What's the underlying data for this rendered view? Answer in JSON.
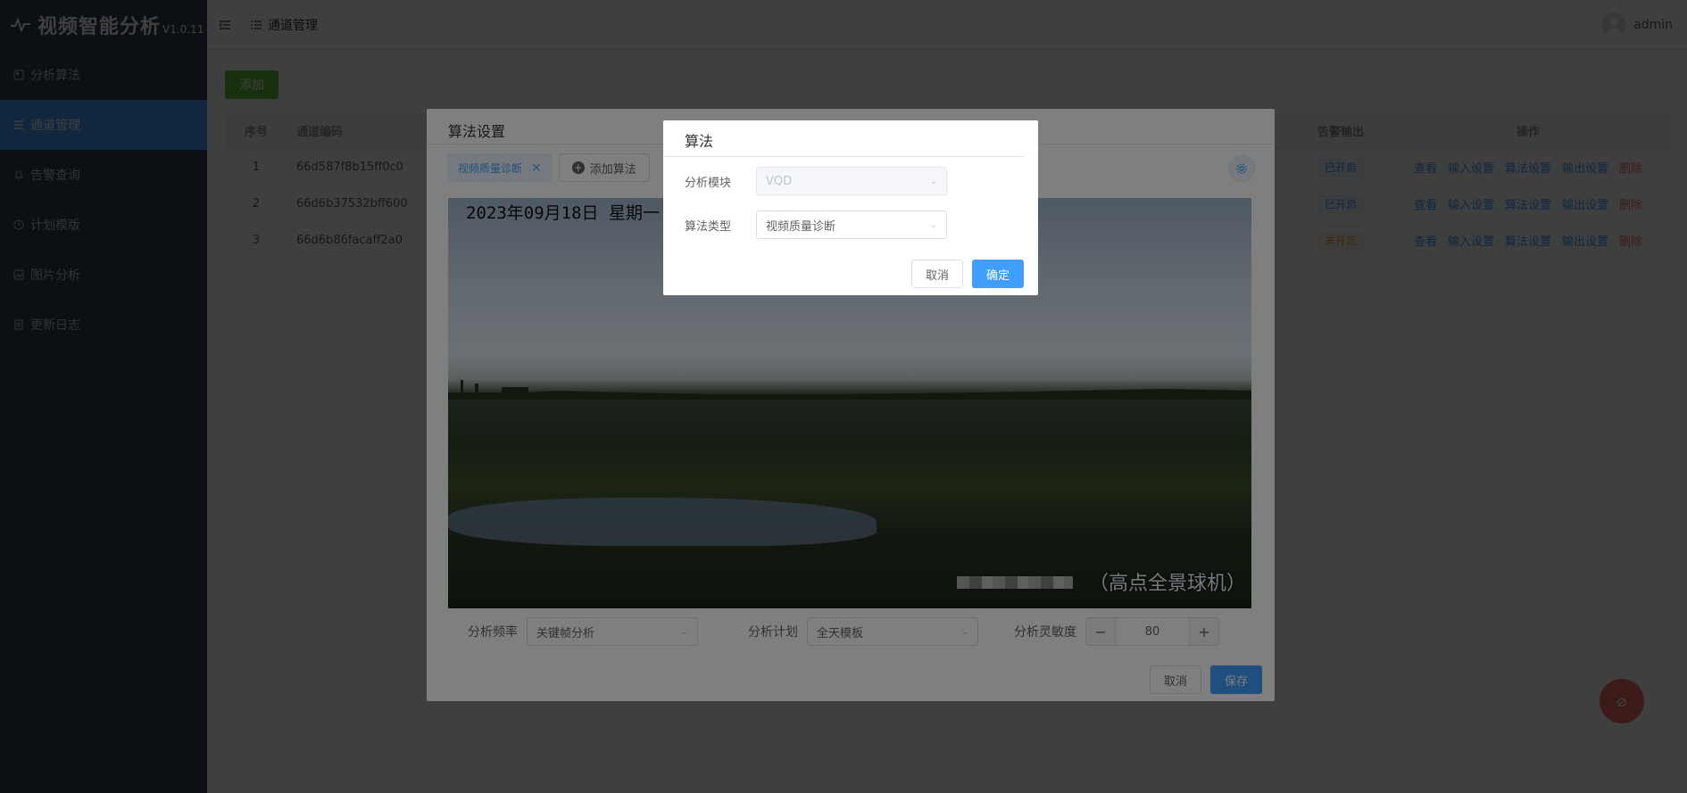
{
  "app": {
    "title": "视频智能分析",
    "version": "V1.0.11"
  },
  "sidebar": {
    "items": [
      {
        "label": "分析算法",
        "icon": "algorithm-icon"
      },
      {
        "label": "通道管理",
        "icon": "list-icon",
        "active": true
      },
      {
        "label": "告警查询",
        "icon": "bell-icon"
      },
      {
        "label": "计划模版",
        "icon": "clock-icon"
      },
      {
        "label": "图片分析",
        "icon": "image-icon"
      },
      {
        "label": "更新日志",
        "icon": "document-icon"
      }
    ]
  },
  "header": {
    "breadcrumb": "通道管理",
    "user": "admin"
  },
  "toolbar": {
    "add_label": "添加"
  },
  "table": {
    "headers": {
      "index": "序号",
      "code": "通道编码",
      "alarm_output": "告警输出",
      "actions": "操作"
    },
    "rows": [
      {
        "index": "1",
        "code": "66d587f8b15ff0c0",
        "alarm": "已开启",
        "alarm_on": true
      },
      {
        "index": "2",
        "code": "66d6b37532bff600",
        "alarm": "已开启",
        "alarm_on": true
      },
      {
        "index": "3",
        "code": "66d6b86facaff2a0",
        "alarm": "未开启",
        "alarm_on": false
      }
    ],
    "actions": {
      "view": "查看",
      "input": "输入设置",
      "algorithm": "算法设置",
      "output": "输出设置",
      "delete": "删除"
    }
  },
  "algo_dialog": {
    "title": "算法设置",
    "tag": "视频质量诊断",
    "add_algorithm": "添加算法",
    "video": {
      "osd": "2023年09月18日  星期一",
      "caption": "（高点全景球机）"
    },
    "params": {
      "frequency_label": "分析频率",
      "frequency_value": "关键帧分析",
      "plan_label": "分析计划",
      "plan_value": "全天模板",
      "sensitivity_label": "分析灵敏度",
      "sensitivity_value": "80"
    },
    "cancel": "取消",
    "save": "保存"
  },
  "inner_dialog": {
    "title": "算法",
    "module_label": "分析模块",
    "module_value": "VQD",
    "type_label": "算法类型",
    "type_value": "视频质量诊断",
    "cancel": "取消",
    "confirm": "确定"
  },
  "colors": {
    "primary": "#409eff",
    "success": "#67c23a",
    "danger": "#f56c6c",
    "sidebar": "#304156"
  }
}
